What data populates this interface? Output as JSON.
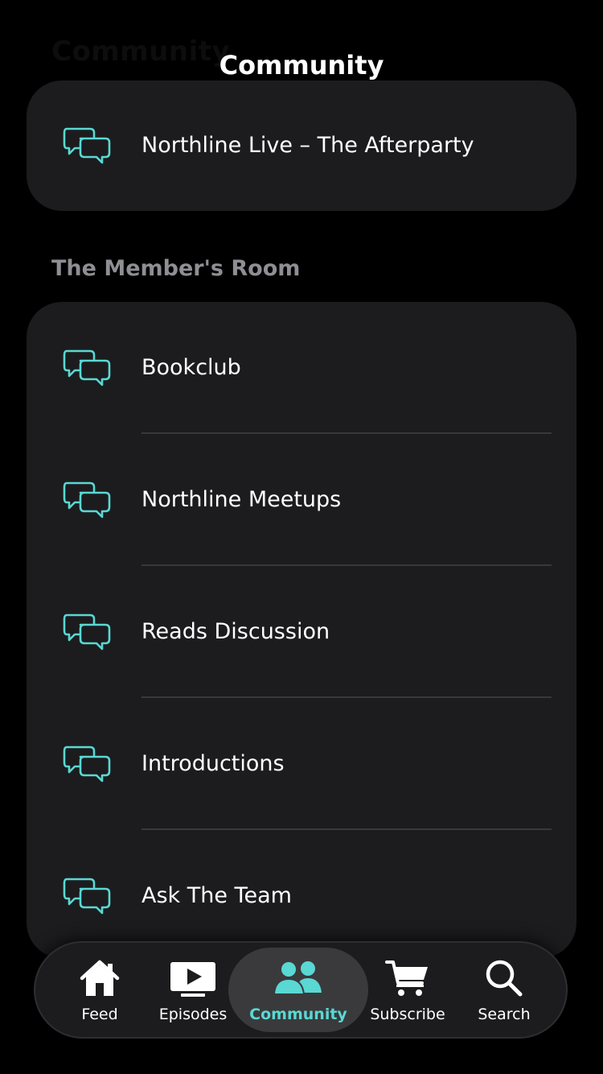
{
  "header": {
    "ghost_title": "Community",
    "title": "Community"
  },
  "featured": {
    "items": [
      {
        "label": "Northline Live – The Afterparty",
        "icon": "chat-bubbles-icon"
      }
    ]
  },
  "members_room": {
    "header": "The Member's Room",
    "items": [
      {
        "label": "Bookclub",
        "icon": "chat-bubbles-icon"
      },
      {
        "label": "Northline Meetups",
        "icon": "chat-bubbles-icon"
      },
      {
        "label": "Reads Discussion",
        "icon": "chat-bubbles-icon"
      },
      {
        "label": "Introductions",
        "icon": "chat-bubbles-icon"
      },
      {
        "label": "Ask The Team",
        "icon": "chat-bubbles-icon"
      }
    ]
  },
  "tabbar": {
    "active": "Community",
    "tabs": [
      {
        "label": "Feed",
        "icon": "house-icon"
      },
      {
        "label": "Episodes",
        "icon": "play-icon"
      },
      {
        "label": "Community",
        "icon": "people-icon"
      },
      {
        "label": "Subscribe",
        "icon": "cart-icon"
      },
      {
        "label": "Search",
        "icon": "magnifier-icon"
      }
    ]
  },
  "colors": {
    "accent": "#5ad8d3",
    "background": "#000000",
    "card": "#1c1c1e",
    "section_header": "#8e8e93",
    "divider": "#38383a"
  }
}
